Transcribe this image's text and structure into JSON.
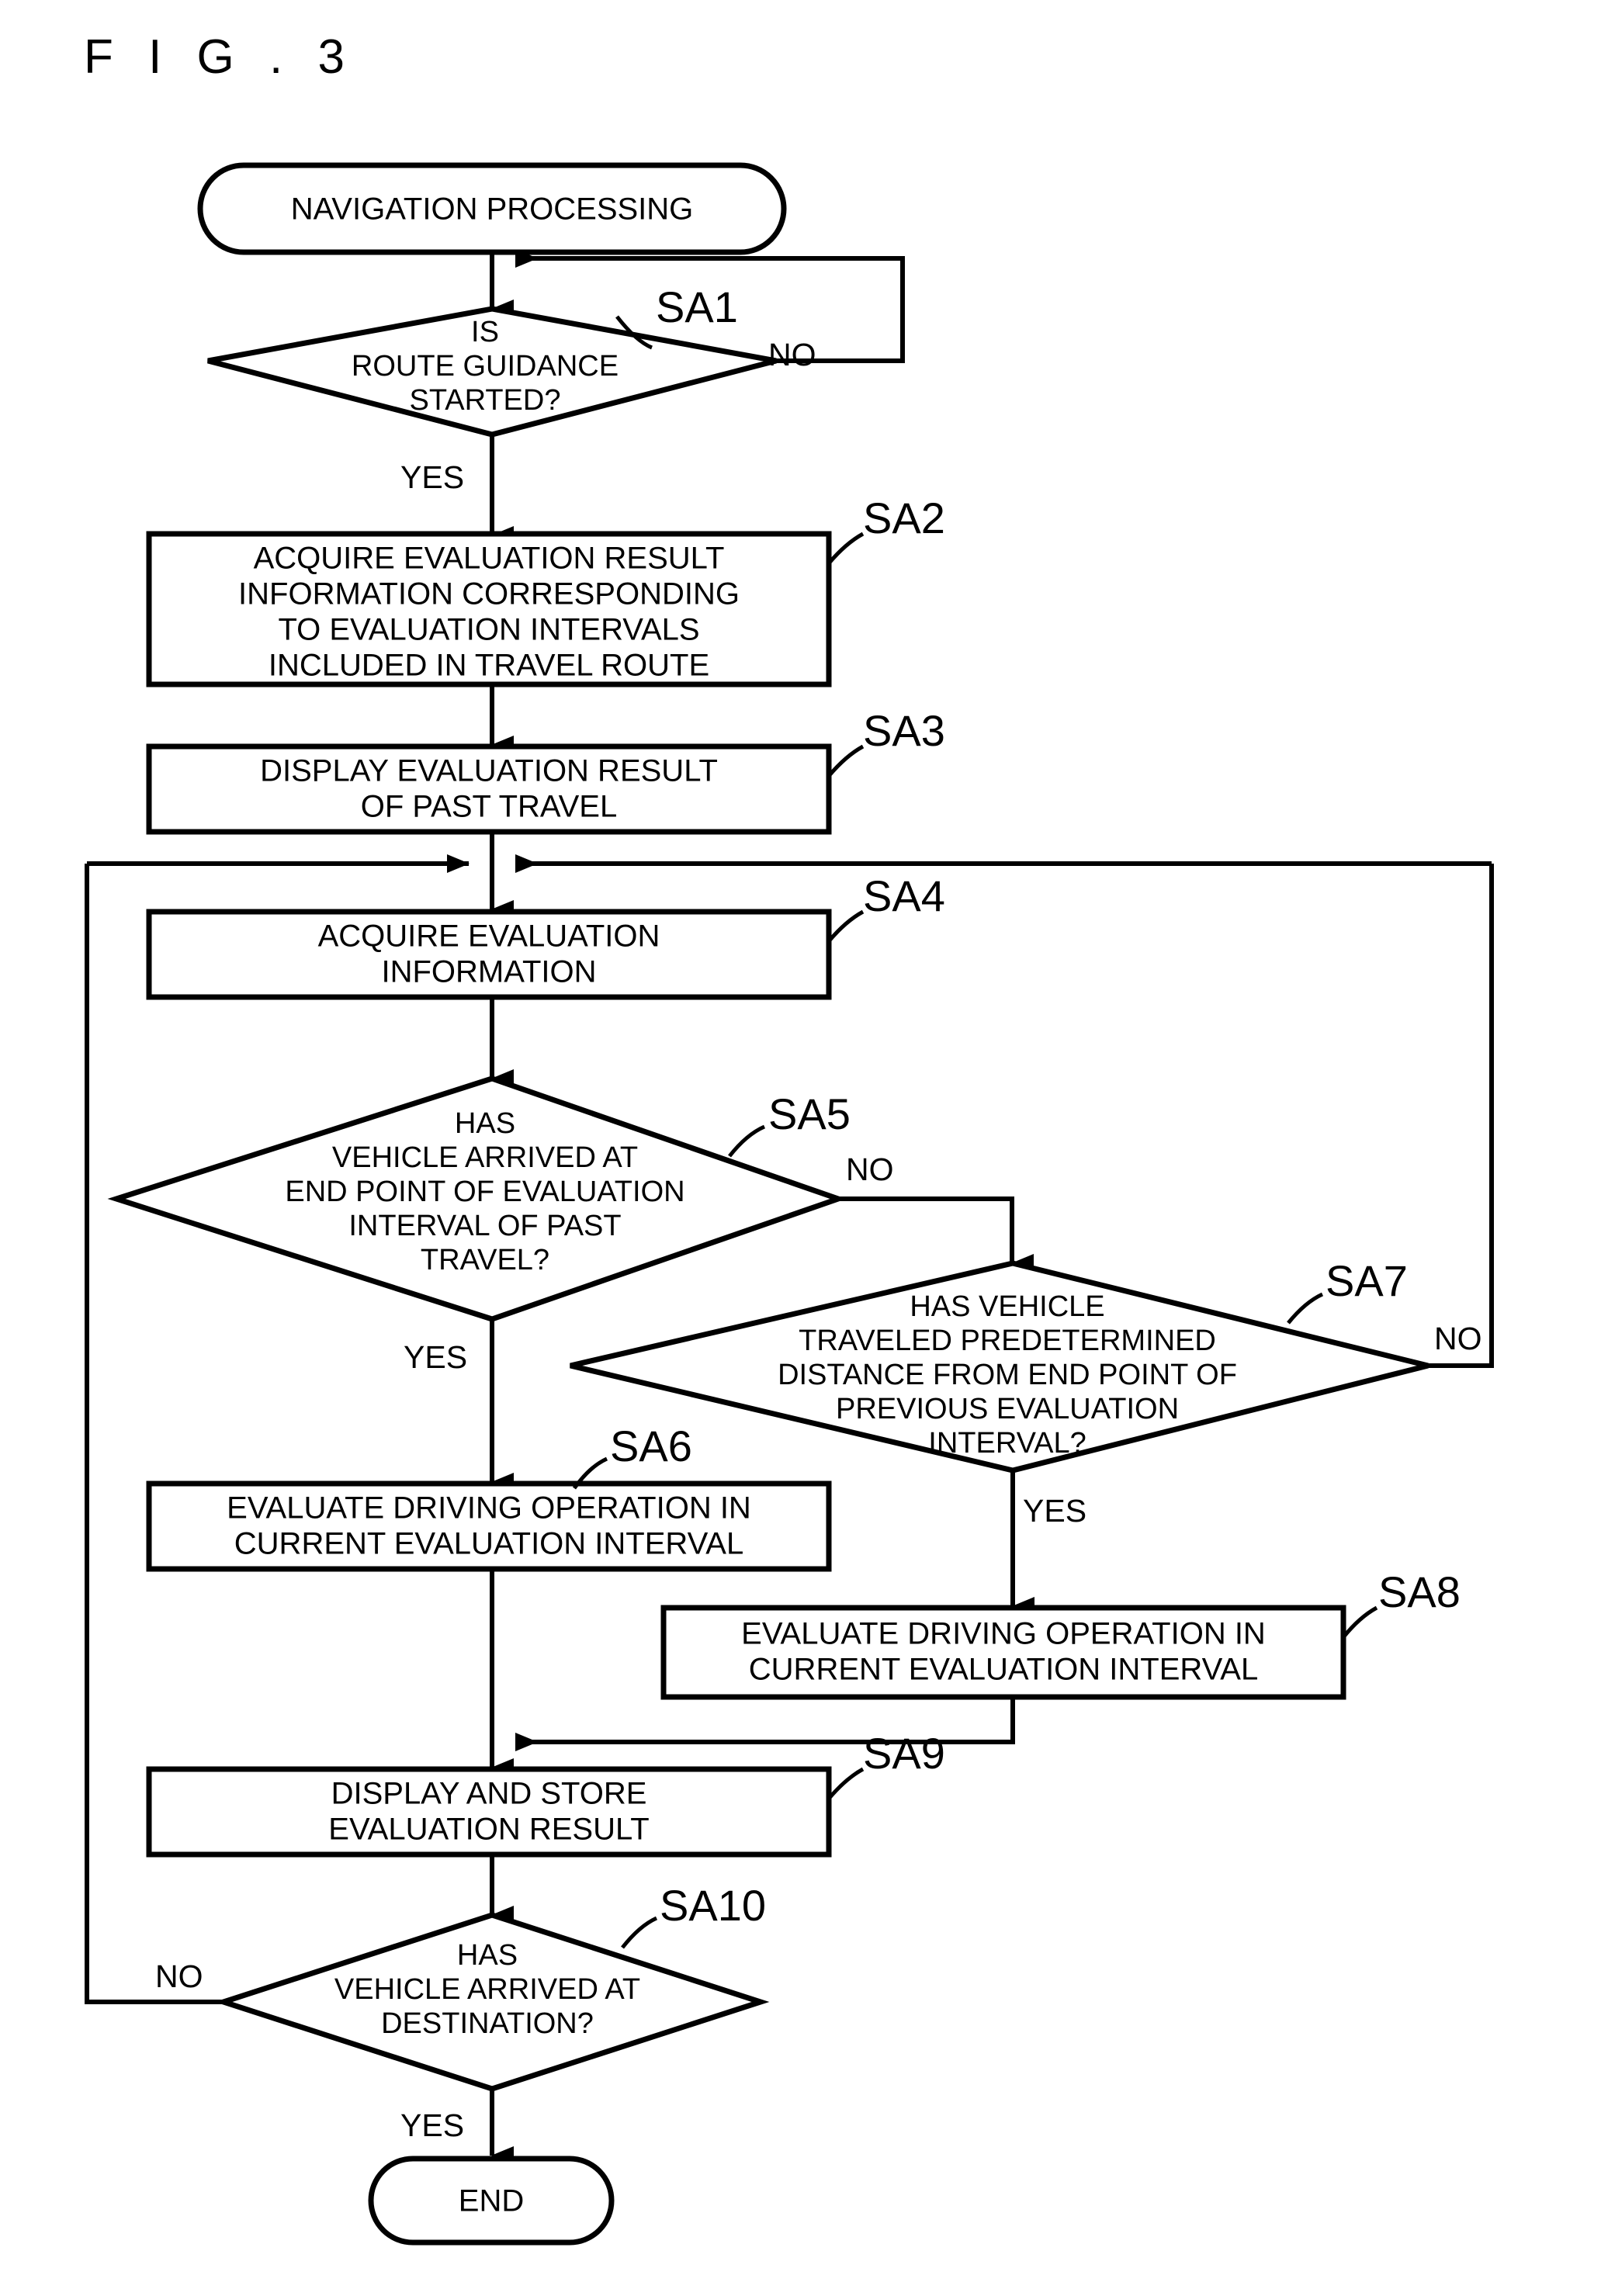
{
  "figure": {
    "title": "F I G . 3"
  },
  "nodes": {
    "start": {
      "id": "start-terminator",
      "label": "NAVIGATION PROCESSING"
    },
    "sa1": {
      "step": "SA1",
      "type": "decision",
      "lines": [
        "IS",
        "ROUTE GUIDANCE",
        "STARTED?"
      ],
      "yes": "YES",
      "no": "NO"
    },
    "sa2": {
      "step": "SA2",
      "type": "process",
      "lines": [
        "ACQUIRE EVALUATION RESULT",
        "INFORMATION CORRESPONDING",
        "TO EVALUATION INTERVALS",
        "INCLUDED IN TRAVEL ROUTE"
      ]
    },
    "sa3": {
      "step": "SA3",
      "type": "process",
      "lines": [
        "DISPLAY EVALUATION RESULT",
        "OF PAST TRAVEL"
      ]
    },
    "sa4": {
      "step": "SA4",
      "type": "process",
      "lines": [
        "ACQUIRE EVALUATION",
        "INFORMATION"
      ]
    },
    "sa5": {
      "step": "SA5",
      "type": "decision",
      "lines": [
        "HAS",
        "VEHICLE ARRIVED AT",
        "END POINT OF EVALUATION",
        "INTERVAL OF PAST",
        "TRAVEL?"
      ],
      "yes": "YES",
      "no": "NO"
    },
    "sa6": {
      "step": "SA6",
      "type": "process",
      "lines": [
        "EVALUATE DRIVING OPERATION IN",
        "CURRENT EVALUATION INTERVAL"
      ]
    },
    "sa7": {
      "step": "SA7",
      "type": "decision",
      "lines": [
        "HAS VEHICLE",
        "TRAVELED PREDETERMINED",
        "DISTANCE FROM END POINT OF",
        "PREVIOUS EVALUATION",
        "INTERVAL?"
      ],
      "yes": "YES",
      "no": "NO"
    },
    "sa8": {
      "step": "SA8",
      "type": "process",
      "lines": [
        "EVALUATE DRIVING OPERATION IN",
        "CURRENT EVALUATION INTERVAL"
      ]
    },
    "sa9": {
      "step": "SA9",
      "type": "process",
      "lines": [
        "DISPLAY AND STORE",
        "EVALUATION RESULT"
      ]
    },
    "sa10": {
      "step": "SA10",
      "type": "decision",
      "lines": [
        "HAS",
        "VEHICLE ARRIVED AT",
        "DESTINATION?"
      ],
      "yes": "YES",
      "no": "NO"
    },
    "end": {
      "id": "end-terminator",
      "label": "END"
    }
  },
  "colors": {
    "stroke": "#000000",
    "fill": "#ffffff",
    "background": "#ffffff"
  }
}
